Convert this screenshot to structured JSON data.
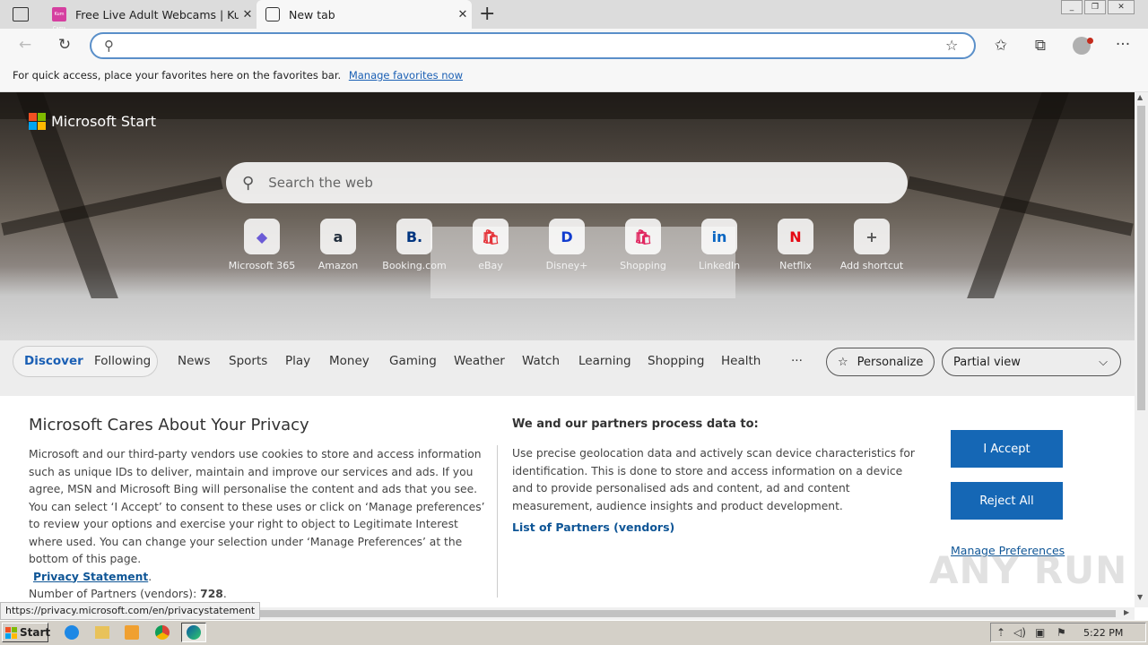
{
  "browser": {
    "tabs": [
      {
        "title": "Free Live Adult Webcams | KumC",
        "favicon_text": "Kum Cams"
      },
      {
        "title": "New tab"
      }
    ],
    "new_tab_symbol": "+",
    "window_controls": [
      "_",
      "❐",
      "✕"
    ],
    "address": {
      "value": "",
      "placeholder": ""
    },
    "favorites_bar": {
      "text": "For quick access, place your favorites here on the favorites bar.",
      "link": "Manage favorites now"
    }
  },
  "newtab": {
    "brand": "Microsoft Start",
    "search_placeholder": "Search the web",
    "quick_links": [
      {
        "label": "Microsoft 365",
        "glyph": "◆",
        "color": "#6b5bd6"
      },
      {
        "label": "Amazon",
        "glyph": "a",
        "color": "#232f3e"
      },
      {
        "label": "Booking.com",
        "glyph": "B.",
        "color": "#003580"
      },
      {
        "label": "eBay",
        "glyph": "🛍",
        "color": "#e53238"
      },
      {
        "label": "Disney+",
        "glyph": "D",
        "color": "#113ccf"
      },
      {
        "label": "Shopping",
        "glyph": "🛍",
        "color": "#e0245e"
      },
      {
        "label": "LinkedIn",
        "glyph": "in",
        "color": "#0a66c2"
      },
      {
        "label": "Netflix",
        "glyph": "N",
        "color": "#e50914"
      },
      {
        "label": "Add shortcut",
        "glyph": "+",
        "color": "#555555"
      }
    ],
    "nav": {
      "pill": [
        "Discover",
        "Following"
      ],
      "items": [
        "News",
        "Sports",
        "Play",
        "Money",
        "Gaming",
        "Weather",
        "Watch",
        "Learning",
        "Shopping",
        "Health"
      ],
      "more": "···",
      "personalize": "Personalize",
      "view_select": "Partial view"
    }
  },
  "cookie_banner": {
    "title": "Microsoft Cares About Your Privacy",
    "text": "Microsoft and our third-party vendors use cookies to store and access information such as unique IDs to deliver, maintain and improve our services and ads. If you agree, MSN and Microsoft Bing will personalise the content and ads that you see. You can select ‘I Accept’ to consent to these uses or click on ‘Manage preferences’ to review your options and exercise your right to object to Legitimate Interest where used.  You can change your selection under ‘Manage Preferences’ at the bottom of this page.",
    "privacy_link": "Privacy Statement",
    "partners_label": "Number of Partners (vendors):",
    "partners_count": "728",
    "purpose_heading": "We and our partners process data to:",
    "purpose_text": "Use precise geolocation data and actively scan device characteristics for identification. This is done to store and access information on a device and to provide personalised ads and content, ad and content measurement, audience insights and product development.",
    "partners_link": "List of Partners (vendors)",
    "accept": "I Accept",
    "reject": "Reject All",
    "manage": "Manage Preferences"
  },
  "status_url": "https://privacy.microsoft.com/en/privacystatement",
  "taskbar": {
    "start": "Start",
    "clock": "5:22 PM"
  },
  "watermark": "ANY RUN",
  "colors": {
    "accent": "#1567b5",
    "link": "#0e5596",
    "address_border": "#5a8fc9"
  }
}
